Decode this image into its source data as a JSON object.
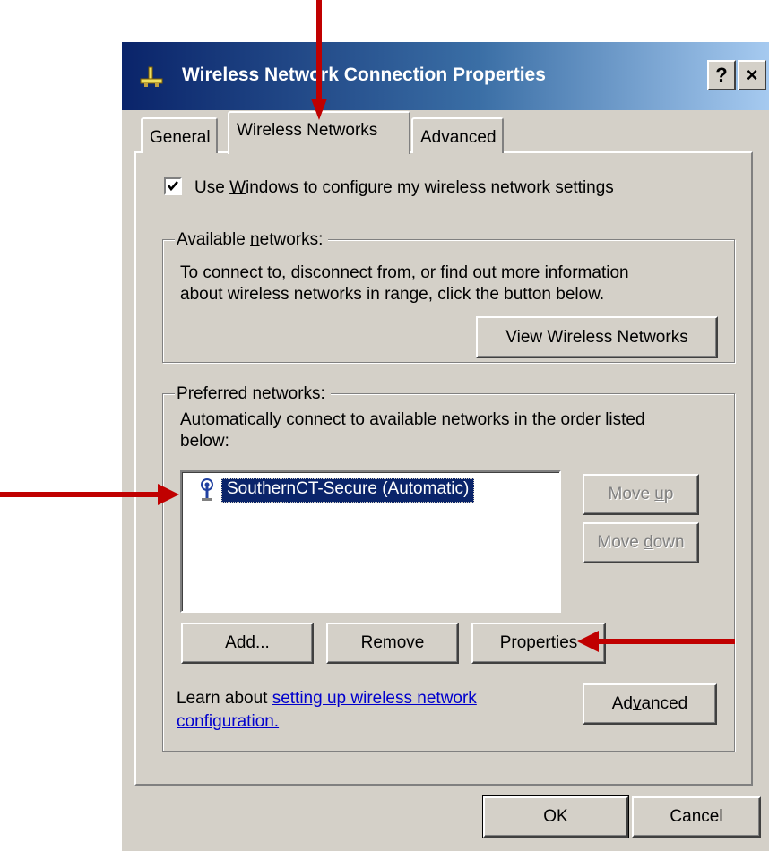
{
  "window": {
    "title": "Wireless Network Connection Properties",
    "help_label": "?",
    "close_label": "×"
  },
  "tabs": [
    {
      "label": "General"
    },
    {
      "label": "Wireless Networks"
    },
    {
      "label": "Advanced"
    }
  ],
  "wireless": {
    "use_windows": {
      "checked": true,
      "prefix": "Use ",
      "mnemonic": "W",
      "suffix": "indows to configure my wireless network settings"
    },
    "available": {
      "legend_prefix": "Available ",
      "legend_mnemonic": "n",
      "legend_suffix": "etworks:",
      "line1": "To connect to, disconnect from, or find out more information",
      "line2": "about wireless networks in range, click the button below.",
      "view_button": "View Wireless Networks"
    },
    "preferred": {
      "legend_mnemonic": "P",
      "legend_suffix": "referred networks:",
      "line1": "Automatically connect to available networks in the order listed",
      "line2": "below:",
      "networks": [
        {
          "name": "SouthernCT-Secure (Automatic)",
          "selected": true
        }
      ],
      "move_up": {
        "prefix": "Move ",
        "mnemonic": "u",
        "suffix": "p"
      },
      "move_down": {
        "prefix": "Move ",
        "mnemonic": "d",
        "suffix": "own"
      },
      "add": {
        "mnemonic": "A",
        "suffix": "dd..."
      },
      "remove": {
        "mnemonic": "R",
        "suffix": "emove"
      },
      "properties": {
        "prefix": "Pr",
        "mnemonic": "o",
        "suffix": "perties"
      }
    },
    "learn_text": "Learn about ",
    "learn_link1": "setting up wireless network",
    "learn_link2": "configuration.",
    "advanced": {
      "prefix": "Ad",
      "mnemonic": "v",
      "suffix": "anced"
    }
  },
  "footer": {
    "ok": "OK",
    "cancel": "Cancel"
  },
  "colors": {
    "annotation_arrow": "#c00000",
    "title_bar": "#0a246a",
    "dialog_face": "#d4d0c8"
  }
}
